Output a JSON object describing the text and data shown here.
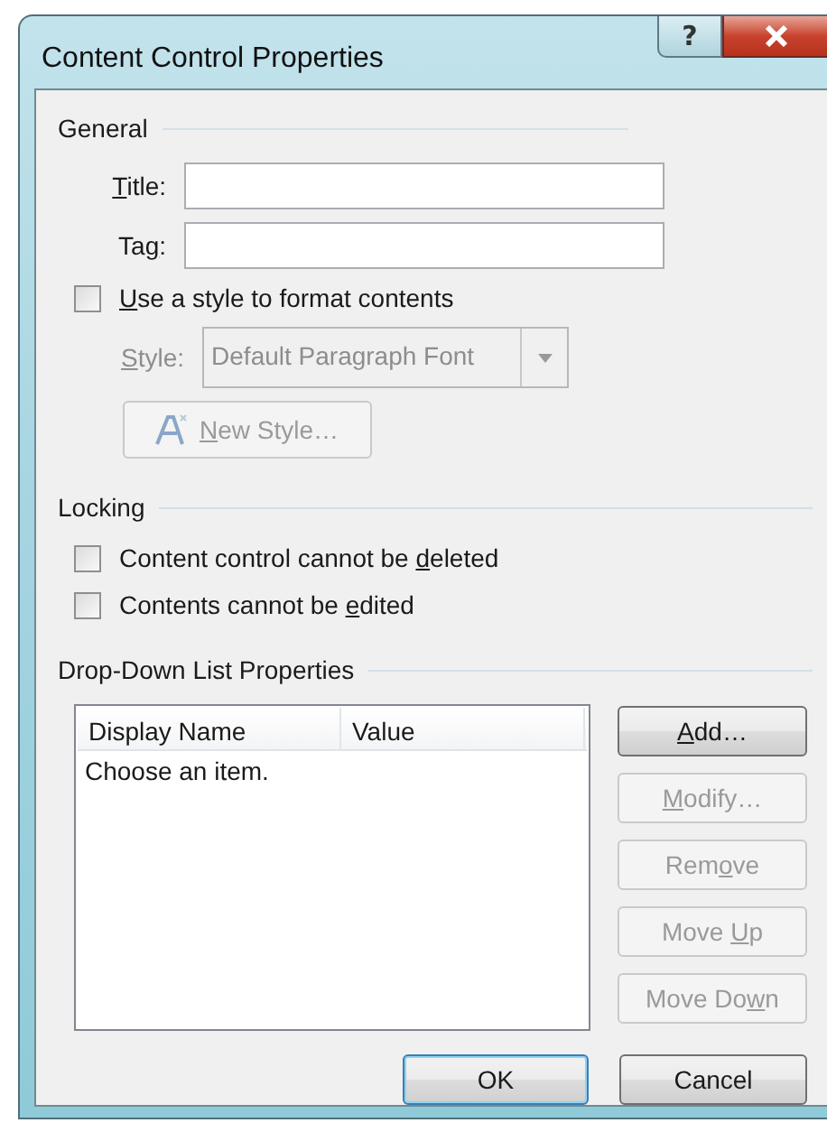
{
  "window": {
    "title": "Content Control Properties",
    "help": "?"
  },
  "general": {
    "heading": "General",
    "fields": [
      {
        "label": {
          "key": "T",
          "post": "itle:"
        }
      },
      {
        "label": {
          "pre": "Ta",
          "key": "g",
          "post": ":"
        }
      }
    ],
    "use_style": {
      "label": {
        "key": "U",
        "post": "se a style to format contents"
      },
      "checked": false
    },
    "style": {
      "label": {
        "key": "S",
        "post": "tyle:"
      },
      "value": "Default Paragraph Font",
      "disabled": true
    },
    "new_style": {
      "label": {
        "key": "N",
        "post": "ew Style…"
      },
      "disabled": true
    }
  },
  "locking": {
    "heading": "Locking",
    "options": [
      {
        "label": {
          "pre": "Content control cannot be ",
          "key": "d",
          "post": "eleted"
        },
        "checked": false
      },
      {
        "label": {
          "pre": "Contents cannot be ",
          "key": "e",
          "post": "dited"
        },
        "checked": false
      }
    ]
  },
  "dropdown": {
    "heading": "Drop-Down List Properties",
    "columns": [
      "Display Name",
      "Value"
    ],
    "rows": [
      {
        "display_name": "Choose an item."
      }
    ],
    "buttons": [
      {
        "label": {
          "key": "A",
          "post": "dd…"
        },
        "disabled": false
      },
      {
        "label": {
          "key": "M",
          "post": "odify…"
        },
        "disabled": true
      },
      {
        "label": {
          "pre": "Rem",
          "key": "o",
          "post": "ve"
        },
        "disabled": true
      },
      {
        "label": {
          "pre": "Move ",
          "key": "U",
          "post": "p"
        },
        "disabled": true
      },
      {
        "label": {
          "pre": "Move Do",
          "key": "w",
          "post": "n"
        },
        "disabled": true
      }
    ]
  },
  "footer": [
    {
      "label": "OK",
      "default": true
    },
    {
      "label": "Cancel",
      "default": false
    }
  ]
}
